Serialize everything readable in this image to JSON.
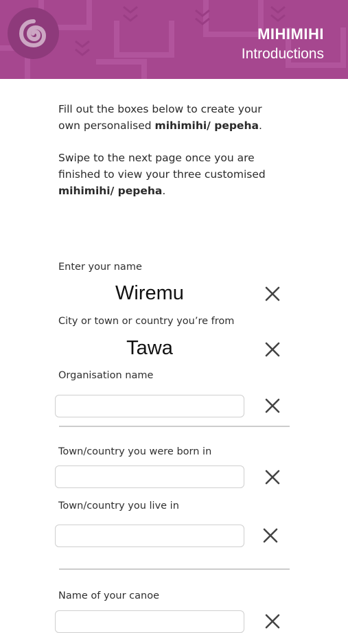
{
  "header": {
    "title": "MIHIMIHI",
    "subtitle": "Introductions",
    "color": "#a6478f"
  },
  "intro": {
    "p1_text": "Fill out the boxes below to create your own personalised",
    "p1_bold": "mihimihi/ pepeha",
    "p1_end": ".",
    "p2_text": "Swipe to the next page once you are finished to view your three customised",
    "p2_bold": "mihimihi/ pepeha",
    "p2_end": "."
  },
  "fields": {
    "name": {
      "label": "Enter your name",
      "value": "Wiremu"
    },
    "city": {
      "label": "City or town or country you’re from",
      "value": "Tawa"
    },
    "organisation": {
      "label": "Organisation name",
      "value": ""
    },
    "born": {
      "label": "Town/country you were born in",
      "value": ""
    },
    "live": {
      "label": "Town/country you live in",
      "value": ""
    },
    "canoe": {
      "label": "Name of your canoe",
      "value": ""
    }
  },
  "icons": {
    "logo": "koru-spiral-icon",
    "clear": "close-icon"
  }
}
